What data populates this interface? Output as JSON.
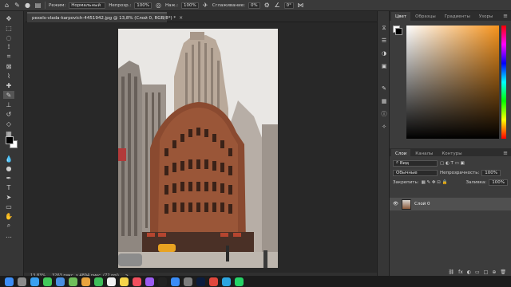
{
  "options_bar": {
    "mode_label": "Режим:",
    "mode_value": "Нормальный",
    "opacity_label": "Непрозр.:",
    "opacity_value": "100%",
    "pressure_label": "Наж.:",
    "pressure_value": "100%",
    "smoothing_label": "Сглаживание:",
    "smoothing_value": "0%",
    "angle_value": "0°"
  },
  "document": {
    "tab_title": "pexels-vlada-karpovich-4451942.jpg @ 13,8% (Слой 0, RGB/8*) *",
    "close_symbol": "×"
  },
  "status_bar": {
    "zoom": "13,83%",
    "doc_info": "3263 пикс. x 4894 пикс. (72 ppi)",
    "arrow": ">"
  },
  "color_panel": {
    "tabs": [
      "Цвет",
      "Образцы",
      "Градиенты",
      "Узоры"
    ],
    "menu_symbol": "≡"
  },
  "layers_panel": {
    "tabs": [
      "Слои",
      "Каналы",
      "Контуры"
    ],
    "menu_symbol": "≡",
    "kind_label": "Вид",
    "blend_value": "Обычные",
    "opacity_label": "Непрозрачность:",
    "opacity_value": "100%",
    "lock_label": "Закрепить:",
    "fill_label": "Заливка:",
    "fill_value": "100%",
    "layer_name": "Слой 0",
    "bottom_icons": [
      "fx",
      "◐",
      "▭",
      "□",
      "⊕",
      "🗑"
    ]
  },
  "icons": {
    "tools": [
      "move",
      "marquee",
      "lasso",
      "quick-select",
      "crop",
      "frame",
      "eyedropper",
      "healing",
      "brush",
      "clone-stamp",
      "history-brush",
      "eraser",
      "gradient",
      "blur",
      "dodge",
      "pen",
      "type",
      "path-select",
      "rectangle",
      "hand",
      "zoom",
      "more"
    ],
    "right_column": [
      "history",
      "properties",
      "adjustments",
      "libraries",
      "brush-settings",
      "swatches",
      "info",
      "paths"
    ]
  },
  "colors": {
    "foreground": "#000000",
    "background": "#ffffff",
    "picker_hue": "#f7941d"
  }
}
